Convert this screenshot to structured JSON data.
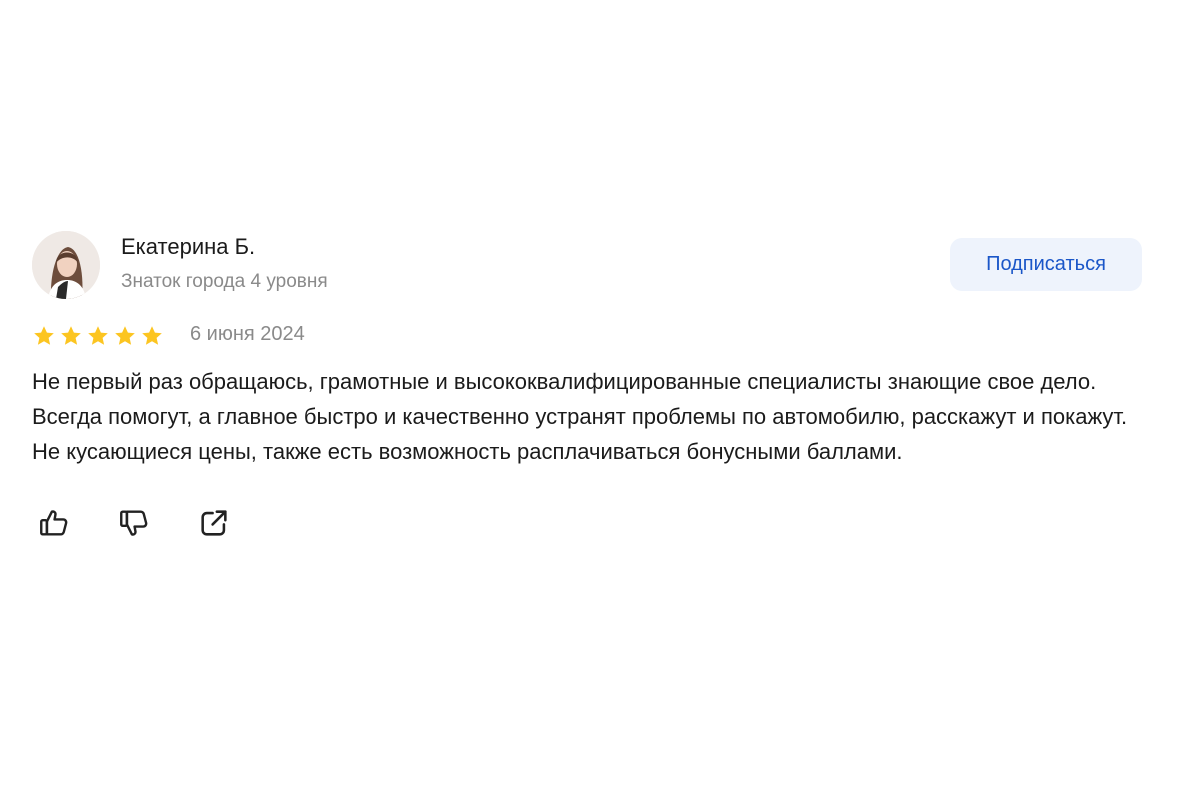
{
  "author": {
    "name": "Екатерина Б.",
    "level": "Знаток города 4 уровня"
  },
  "subscribe_label": "Подписаться",
  "rating": {
    "value": 5,
    "max": 5,
    "star_color": "#fcc521"
  },
  "date": "6 июня 2024",
  "text": "Не первый раз обращаюсь, грамотные и высококвалифицированные специалисты знающие свое дело. Всегда помогут, а главное быстро и качественно устранят проблемы по автомобилю, расскажут и покажут. Не кусающиеся цены, также есть возможность расплачиваться бонусными баллами.",
  "actions": [
    {
      "icon": "thumbs-up-icon"
    },
    {
      "icon": "thumbs-down-icon"
    },
    {
      "icon": "share-icon"
    }
  ],
  "colors": {
    "accent": "#1a56c8",
    "button_bg": "#eef3fc",
    "secondary_text": "#8a8a8a",
    "primary_text": "#1b1b1b"
  }
}
